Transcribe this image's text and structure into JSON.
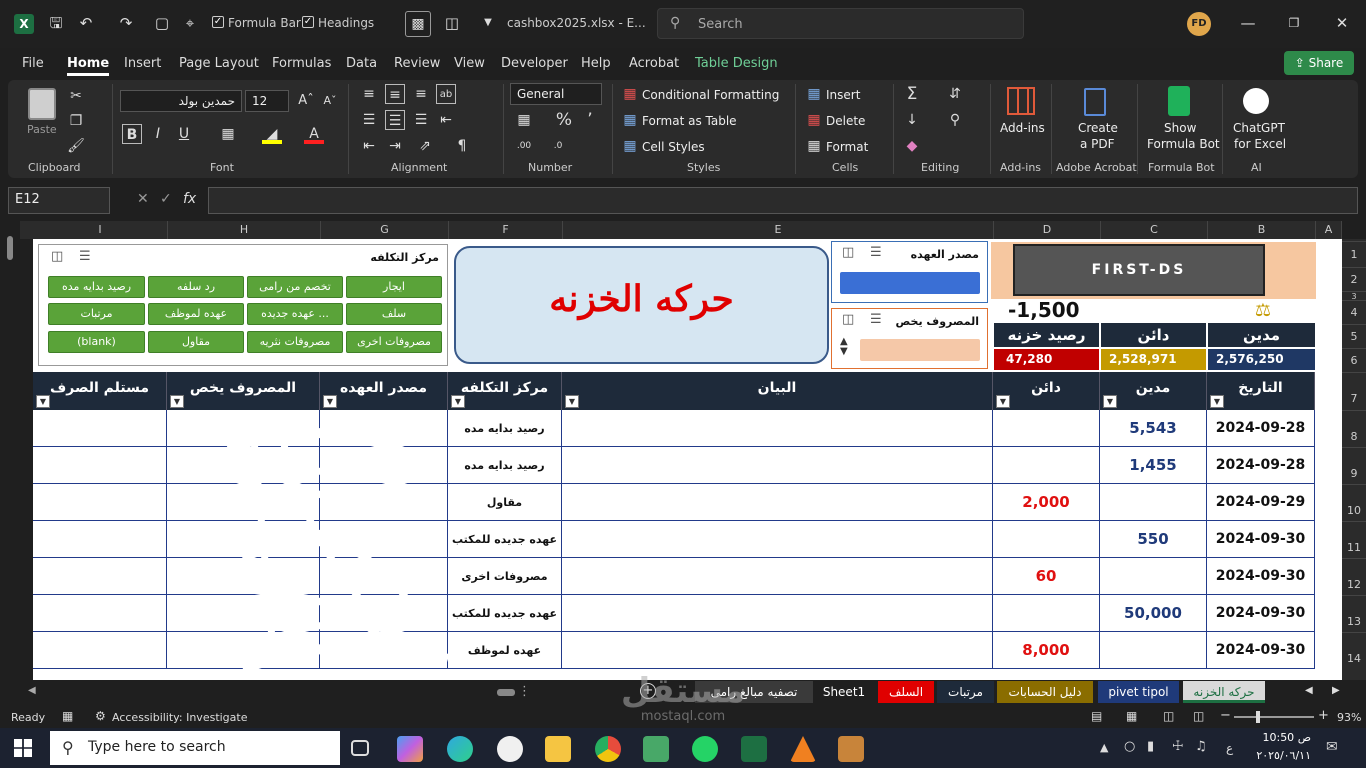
{
  "titlebar": {
    "formula_bar_label": "Formula Bar",
    "headings_label": "Headings",
    "filename": "cashbox2025.xlsx  -  E...",
    "search_placeholder": "Search",
    "user_initials": "FD"
  },
  "menu": {
    "items": [
      "File",
      "Home",
      "Insert",
      "Page Layout",
      "Formulas",
      "Data",
      "Review",
      "View",
      "Developer",
      "Help",
      "Acrobat",
      "Table Design"
    ],
    "active": "Home",
    "share_label": "Share"
  },
  "ribbon": {
    "clipboard": {
      "paste": "Paste",
      "label": "Clipboard"
    },
    "font": {
      "name": "حمدين بولد",
      "size": "12",
      "label": "Font"
    },
    "alignment": {
      "label": "Alignment"
    },
    "number": {
      "format": "General",
      "label": "Number"
    },
    "styles": {
      "conditional": "Conditional Formatting",
      "format_table": "Format as Table",
      "cell_styles": "Cell Styles",
      "label": "Styles"
    },
    "cells": {
      "insert": "Insert",
      "delete": "Delete",
      "format": "Format",
      "label": "Cells"
    },
    "editing": {
      "label": "Editing"
    },
    "addins": {
      "btn": "Add-ins",
      "label": "Add-ins"
    },
    "adobe": {
      "btn1": "Create",
      "btn2": "a PDF",
      "label": "Adobe Acrobat"
    },
    "formulabot": {
      "btn1": "Show",
      "btn2": "Formula Bot",
      "label": "Formula Bot"
    },
    "ai": {
      "btn1": "ChatGPT",
      "btn2": "for Excel",
      "label": "AI"
    }
  },
  "formula_bar": {
    "cell_ref": "E12",
    "fx": "fx"
  },
  "columns": [
    "I",
    "H",
    "G",
    "F",
    "E",
    "D",
    "C",
    "B",
    "A"
  ],
  "rows": [
    "1",
    "2",
    "3",
    "4",
    "5",
    "6",
    "7",
    "8",
    "9",
    "10",
    "11",
    "12",
    "13",
    "14"
  ],
  "slicer_cost": {
    "title": "مركز التكلفه",
    "buttons": [
      "ايجار",
      "تخصم من رامى",
      "رد سلفه",
      "رصيد بدايه مده",
      "سلف",
      "عهده جديده ...",
      "عهده لموظف",
      "مرتبات",
      "مصروفات اخرى",
      "مصروفات نثريه",
      "مقاول",
      "(blank)"
    ]
  },
  "banner_title": "حركه الخزنه",
  "slicer_source": {
    "title": "مصدر العهده"
  },
  "slicer_expense": {
    "title": "المصروف  يخص"
  },
  "logo_text": "FIRST-DS",
  "summary": {
    "balance_top": "-1,500",
    "labels": {
      "balance": "رصيد خزنه",
      "dain": "دائن",
      "madin": "مدين"
    },
    "values": {
      "balance": "47,280",
      "dain": "2,528,971",
      "madin": "2,576,250"
    },
    "colors": {
      "balance": "#c00000",
      "dain": "#c49a00",
      "madin": "#1f3864"
    }
  },
  "table_headers": {
    "receiver": "مستلم الصرف",
    "expense_for": "المصروف  يخص",
    "source": "مصدر العهده",
    "cost_center": "مركز التكلفه",
    "statement": "البيان",
    "dain": "دائن",
    "madin": "مدين",
    "date": "التاريخ"
  },
  "table_rows": [
    {
      "date": "2024-09-28",
      "madin": "5,543",
      "dain": "",
      "cost": "رصيد بدايه مده"
    },
    {
      "date": "2024-09-28",
      "madin": "1,455",
      "dain": "",
      "cost": "رصيد بدايه مده"
    },
    {
      "date": "2024-09-29",
      "madin": "",
      "dain": "2,000",
      "cost": "مقاول"
    },
    {
      "date": "2024-09-30",
      "madin": "550",
      "dain": "",
      "cost": "عهده جديده للمكتب"
    },
    {
      "date": "2024-09-30",
      "madin": "",
      "dain": "60",
      "cost": "مصروفات اخرى"
    },
    {
      "date": "2024-09-30",
      "madin": "50,000",
      "dain": "",
      "cost": "عهده جديده للمكتب"
    },
    {
      "date": "2024-09-30",
      "madin": "",
      "dain": "8,000",
      "cost": "عهده لموظف"
    }
  ],
  "sheet_tabs": [
    {
      "label": "تصفيه مبالغ رامى",
      "bg": "#3a3a3a"
    },
    {
      "label": "Sheet1",
      "bg": "#1f1f1f"
    },
    {
      "label": "السلف",
      "bg": "#e00000"
    },
    {
      "label": "مرتبات",
      "bg": "#1e2a3a"
    },
    {
      "label": "دليل الحسابات",
      "bg": "#8a6d00"
    },
    {
      "label": "pivet tipol",
      "bg": "#1f3a7a"
    },
    {
      "label": "حركه الخزنه",
      "bg": "#d9d9d9"
    }
  ],
  "status": {
    "ready": "Ready",
    "accessibility": "Accessibility: Investigate",
    "zoom": "93%"
  },
  "taskbar": {
    "search_placeholder": "Type here to search",
    "time": "10:50 ص",
    "date": "٢٠٢٥/٠٦/١١"
  },
  "watermark": {
    "text": "مستقل",
    "sub": "mostaql.com"
  }
}
